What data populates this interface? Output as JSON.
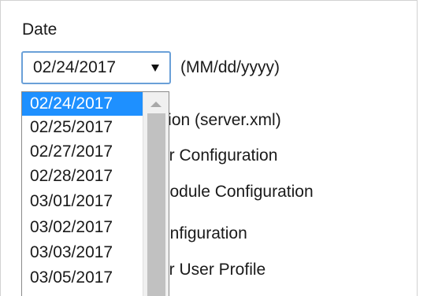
{
  "form": {
    "date_label": "Date",
    "format_hint": "(MM/dd/yyyy)",
    "selected_value": "02/24/2017"
  },
  "dropdown": {
    "options": [
      "02/24/2017",
      "02/25/2017",
      "02/27/2017",
      "02/28/2017",
      "03/01/2017",
      "03/02/2017",
      "03/03/2017",
      "03/05/2017"
    ],
    "selected_index": 0
  },
  "background_items": [
    "uration (server.xml)",
    "er Configuration",
    "Module Configuration",
    "onfiguration",
    "er User Profile"
  ],
  "colors": {
    "selection": "#1e90ff",
    "focus_border": "#6aa0d8"
  },
  "icons": {
    "select_arrow": "triangle-down",
    "scroll_up": "triangle-up"
  }
}
